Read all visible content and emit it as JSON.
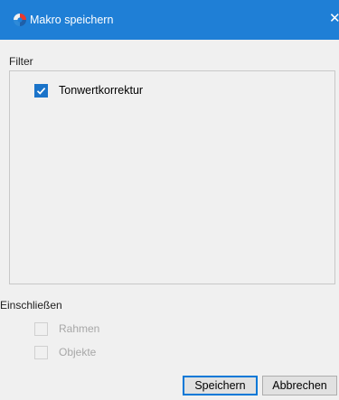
{
  "window": {
    "title": "Makro speichern",
    "close_glyph": "✕",
    "app_icon": "photo-app-logo-icon"
  },
  "filter": {
    "label": "Filter",
    "items": [
      {
        "label": "Tonwertkorrektur",
        "checked": true
      }
    ]
  },
  "include": {
    "label": "Einschließen",
    "options": [
      {
        "label": "Rahmen",
        "checked": false,
        "enabled": false
      },
      {
        "label": "Objekte",
        "checked": false,
        "enabled": false
      }
    ]
  },
  "buttons": {
    "save": "Speichern",
    "cancel": "Abbrechen"
  },
  "colors": {
    "titlebar": "#1f7fd6",
    "checkbox_checked": "#1a73c9",
    "default_button_border": "#0078d7"
  }
}
